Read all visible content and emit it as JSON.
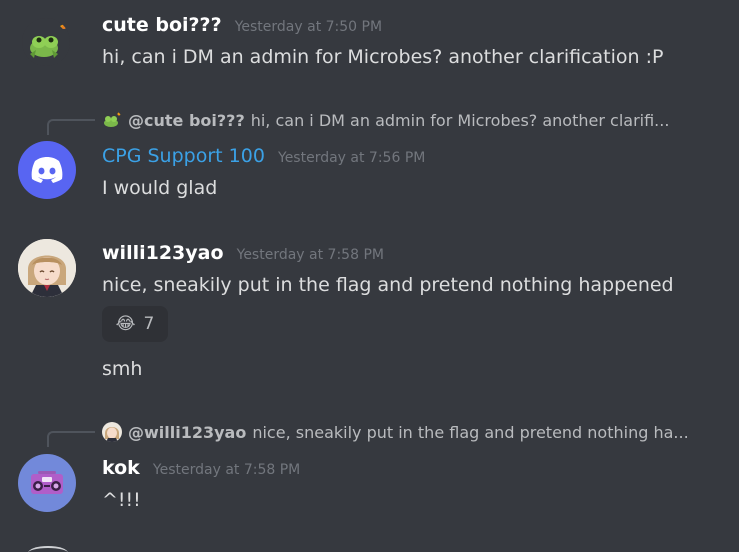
{
  "messages": [
    {
      "username": "cute boi???",
      "timestamp": "Yesterday at 7:50 PM",
      "content": "hi, can i DM an admin for Microbes? another clarification :P",
      "avatar_icon": "frog-icon"
    },
    {
      "reply_to_user": "@cute boi???",
      "reply_preview": "hi, can i DM an admin for Microbes? another clarifi...",
      "username": "CPG Support 100",
      "username_color": "#3ba1e6",
      "timestamp": "Yesterday at 7:56 PM",
      "content": "I would glad",
      "avatar_icon": "discord-logo-icon"
    },
    {
      "username": "willi123yao",
      "timestamp": "Yesterday at 7:58 PM",
      "content": "nice, sneakily put in the flag and pretend nothing happened",
      "reaction": {
        "emoji": "😂",
        "count": "7"
      },
      "followup": "smh",
      "avatar_icon": "anime-avatar-icon"
    },
    {
      "reply_to_user": "@willi123yao",
      "reply_preview": "nice, sneakily put in the flag and pretend nothing ha...",
      "username": "kok",
      "timestamp": "Yesterday at 7:58 PM",
      "content": "^!!!",
      "avatar_icon": "boombox-icon"
    }
  ],
  "colors": {
    "background": "#36393f",
    "text": "#dcddde",
    "timestamp": "#72767d",
    "discord_blurple": "#5865f2",
    "kok_avatar": "#7289da"
  }
}
